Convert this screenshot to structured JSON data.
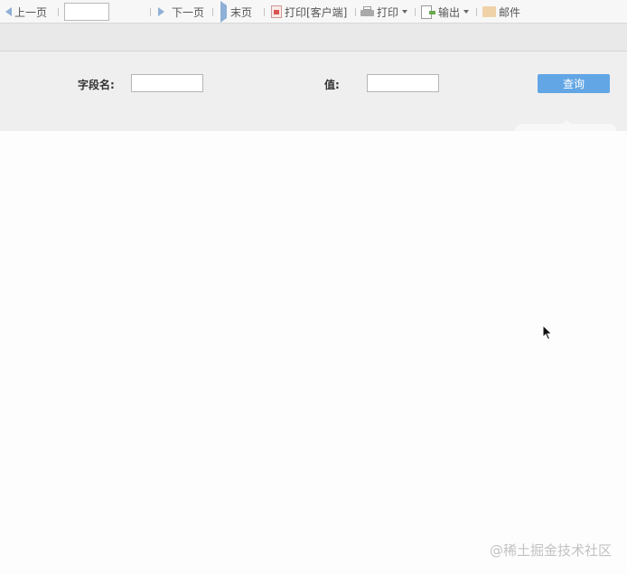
{
  "toolbar": {
    "prev_page": "上一页",
    "page_input_value": "",
    "next_page": "下一页",
    "last_page": "末页",
    "print_client": "打印[客户端]",
    "print": "打印",
    "export": "输出",
    "mail": "邮件"
  },
  "query_form": {
    "field_name_label": "字段名:",
    "field_name_value": "",
    "value_label": "值:",
    "value_value": "",
    "query_button": "查询"
  },
  "watermark": "@稀土掘金技术社区"
}
